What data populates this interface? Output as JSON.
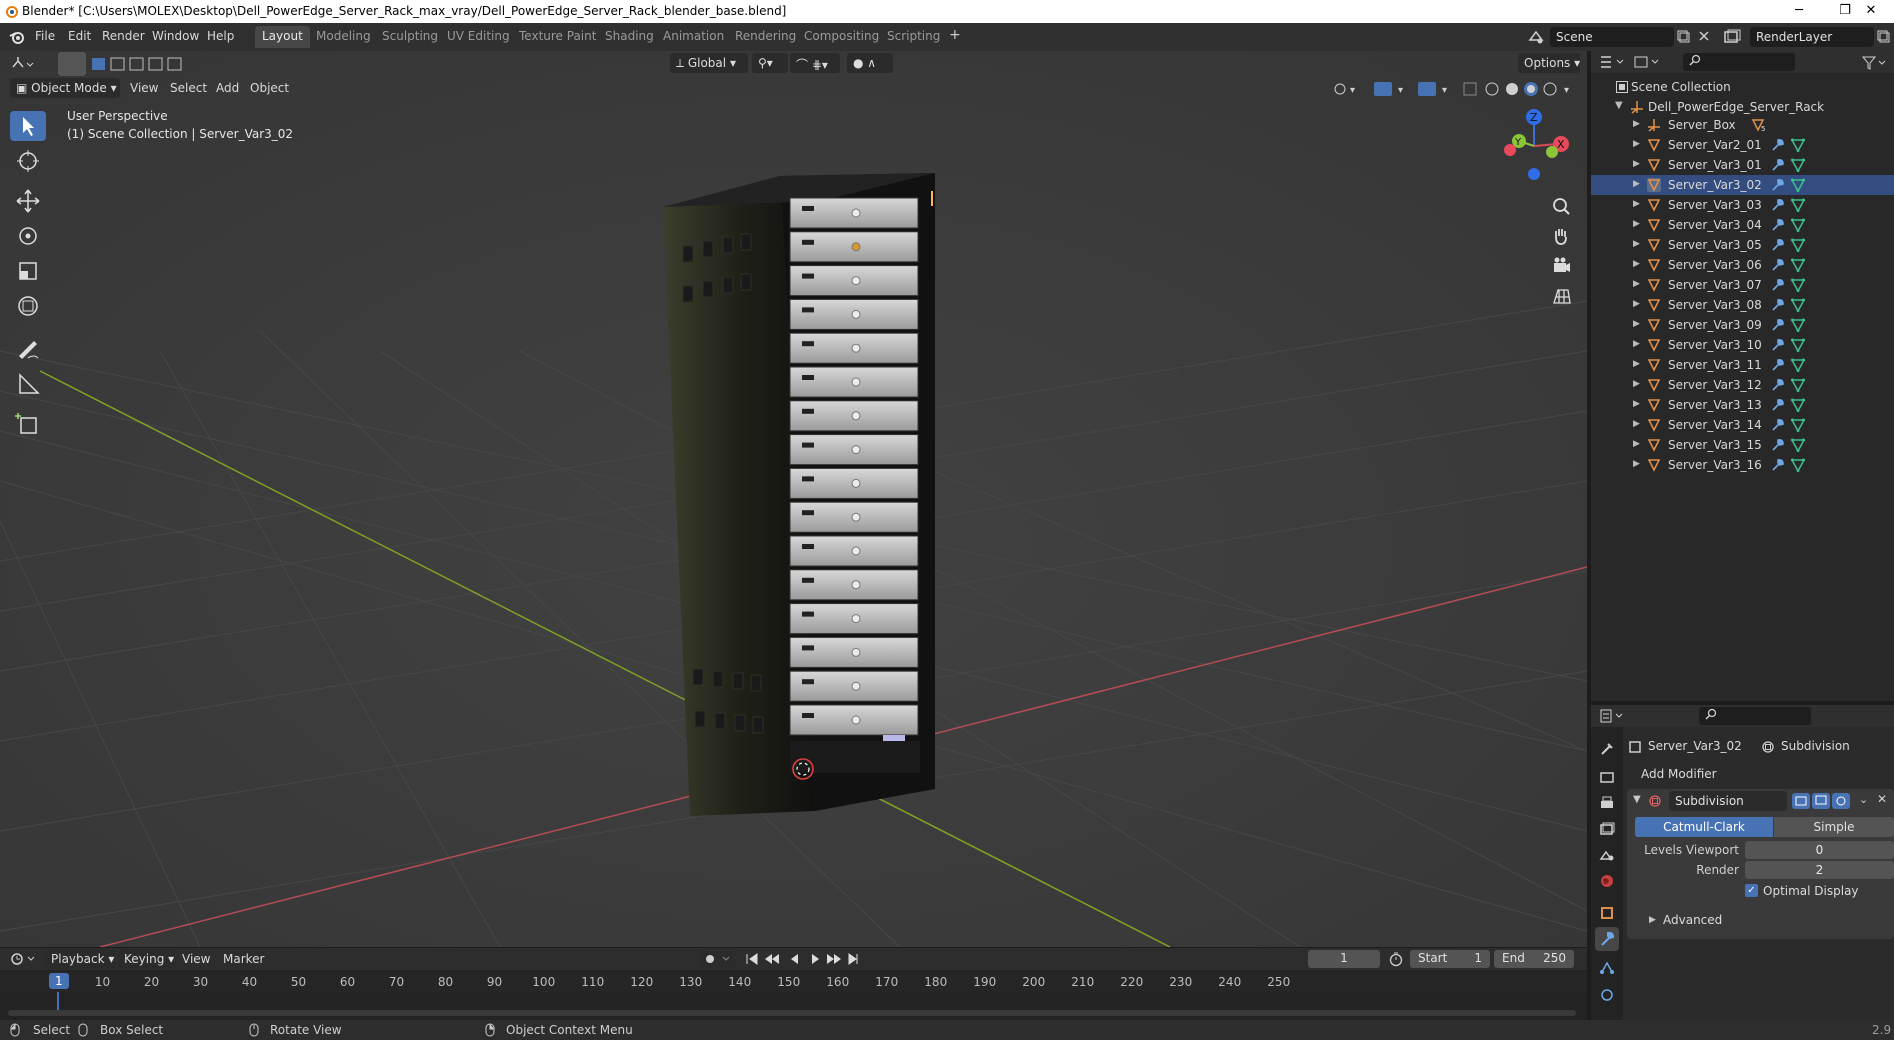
{
  "title_bar": {
    "title": "Blender* [C:\\Users\\MOLEX\\Desktop\\Dell_PowerEdge_Server_Rack_max_vray/Dell_PowerEdge_Server_Rack_blender_base.blend]",
    "minimize": "─",
    "maximize": "❐",
    "close": "✕"
  },
  "menu": {
    "items": [
      "File",
      "Edit",
      "Render",
      "Window",
      "Help"
    ]
  },
  "workspaces": {
    "tabs": [
      "Layout",
      "Modeling",
      "Sculpting",
      "UV Editing",
      "Texture Paint",
      "Shading",
      "Animation",
      "Rendering",
      "Compositing",
      "Scripting"
    ],
    "active": "Layout",
    "add": "+"
  },
  "scene": {
    "scene_name": "Scene",
    "view_layer": "RenderLayer"
  },
  "viewport": {
    "mode": "Object Mode",
    "menus": [
      "View",
      "Select",
      "Add",
      "Object"
    ],
    "transform_orientation": "Global",
    "options_label": "Options",
    "overlay_line1": "User Perspective",
    "overlay_line2": "(1) Scene Collection | Server_Var3_02",
    "gizmo": {
      "z": "Z",
      "y": "Y",
      "x": "X"
    }
  },
  "outliner": {
    "root": "Scene Collection",
    "collection": "Dell_PowerEdge_Server_Rack",
    "items": [
      {
        "name": "Server_Box",
        "type": "empty"
      },
      {
        "name": "Server_Var2_01",
        "type": "mesh"
      },
      {
        "name": "Server_Var3_01",
        "type": "mesh"
      },
      {
        "name": "Server_Var3_02",
        "type": "mesh",
        "selected": true
      },
      {
        "name": "Server_Var3_03",
        "type": "mesh"
      },
      {
        "name": "Server_Var3_04",
        "type": "mesh"
      },
      {
        "name": "Server_Var3_05",
        "type": "mesh"
      },
      {
        "name": "Server_Var3_06",
        "type": "mesh"
      },
      {
        "name": "Server_Var3_07",
        "type": "mesh"
      },
      {
        "name": "Server_Var3_08",
        "type": "mesh"
      },
      {
        "name": "Server_Var3_09",
        "type": "mesh"
      },
      {
        "name": "Server_Var3_10",
        "type": "mesh"
      },
      {
        "name": "Server_Var3_11",
        "type": "mesh"
      },
      {
        "name": "Server_Var3_12",
        "type": "mesh"
      },
      {
        "name": "Server_Var3_13",
        "type": "mesh"
      },
      {
        "name": "Server_Var3_14",
        "type": "mesh"
      },
      {
        "name": "Server_Var3_15",
        "type": "mesh"
      },
      {
        "name": "Server_Var3_16",
        "type": "mesh"
      }
    ]
  },
  "properties": {
    "object_name": "Server_Var3_02",
    "modifier_tab": "Subdivision",
    "add_modifier": "Add Modifier",
    "modifier": {
      "name": "Subdivision",
      "type_catmull": "Catmull-Clark",
      "type_simple": "Simple",
      "levels_viewport_label": "Levels Viewport",
      "levels_viewport_value": "0",
      "render_label": "Render",
      "render_value": "2",
      "optimal_display_label": "Optimal Display",
      "optimal_display_checked": true,
      "advanced_label": "Advanced"
    }
  },
  "timeline": {
    "menus": [
      "Playback",
      "Keying",
      "View",
      "Marker"
    ],
    "current_frame": "1",
    "start_label": "Start",
    "start_value": "1",
    "end_label": "End",
    "end_value": "250",
    "ruler": [
      "1",
      "10",
      "20",
      "30",
      "40",
      "50",
      "60",
      "70",
      "80",
      "90",
      "100",
      "110",
      "120",
      "130",
      "140",
      "150",
      "160",
      "170",
      "180",
      "190",
      "200",
      "210",
      "220",
      "230",
      "240",
      "250"
    ]
  },
  "status_bar": {
    "select": "Select",
    "box_select": "Box Select",
    "rotate_view": "Rotate View",
    "context_menu": "Object Context Menu",
    "version": "2.9"
  },
  "colors": {
    "accent": "#4772b3",
    "x_axis": "#b44d54",
    "y_axis": "#7ea324",
    "mesh_icon": "#e0904b",
    "modifier_icon": "#6ea7e6",
    "data_icon": "#39c28e"
  }
}
